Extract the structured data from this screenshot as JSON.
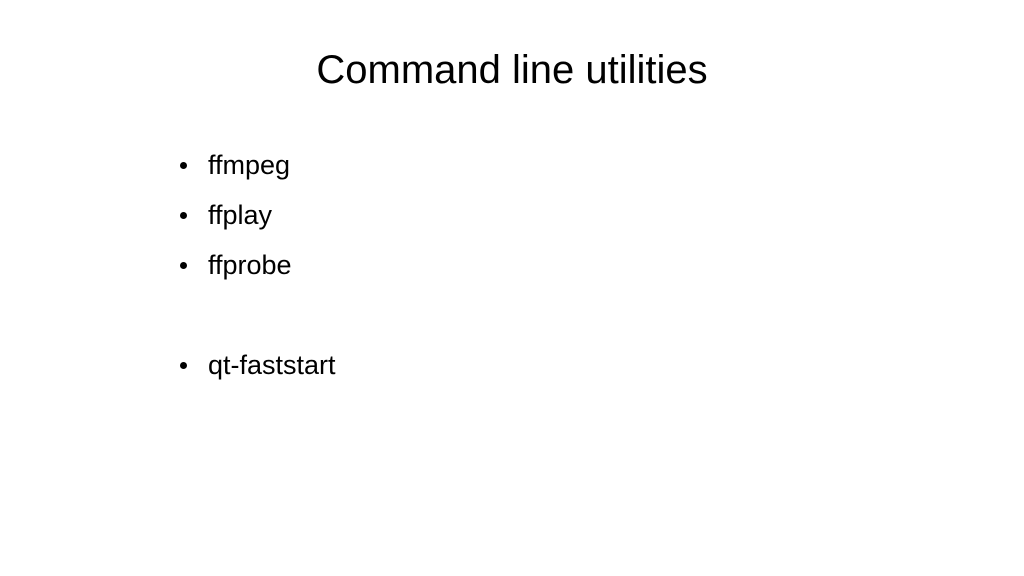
{
  "slide": {
    "title": "Command line utilities",
    "items": [
      "ffmpeg",
      "ffplay",
      "ffprobe",
      "",
      "qt-faststart"
    ]
  }
}
